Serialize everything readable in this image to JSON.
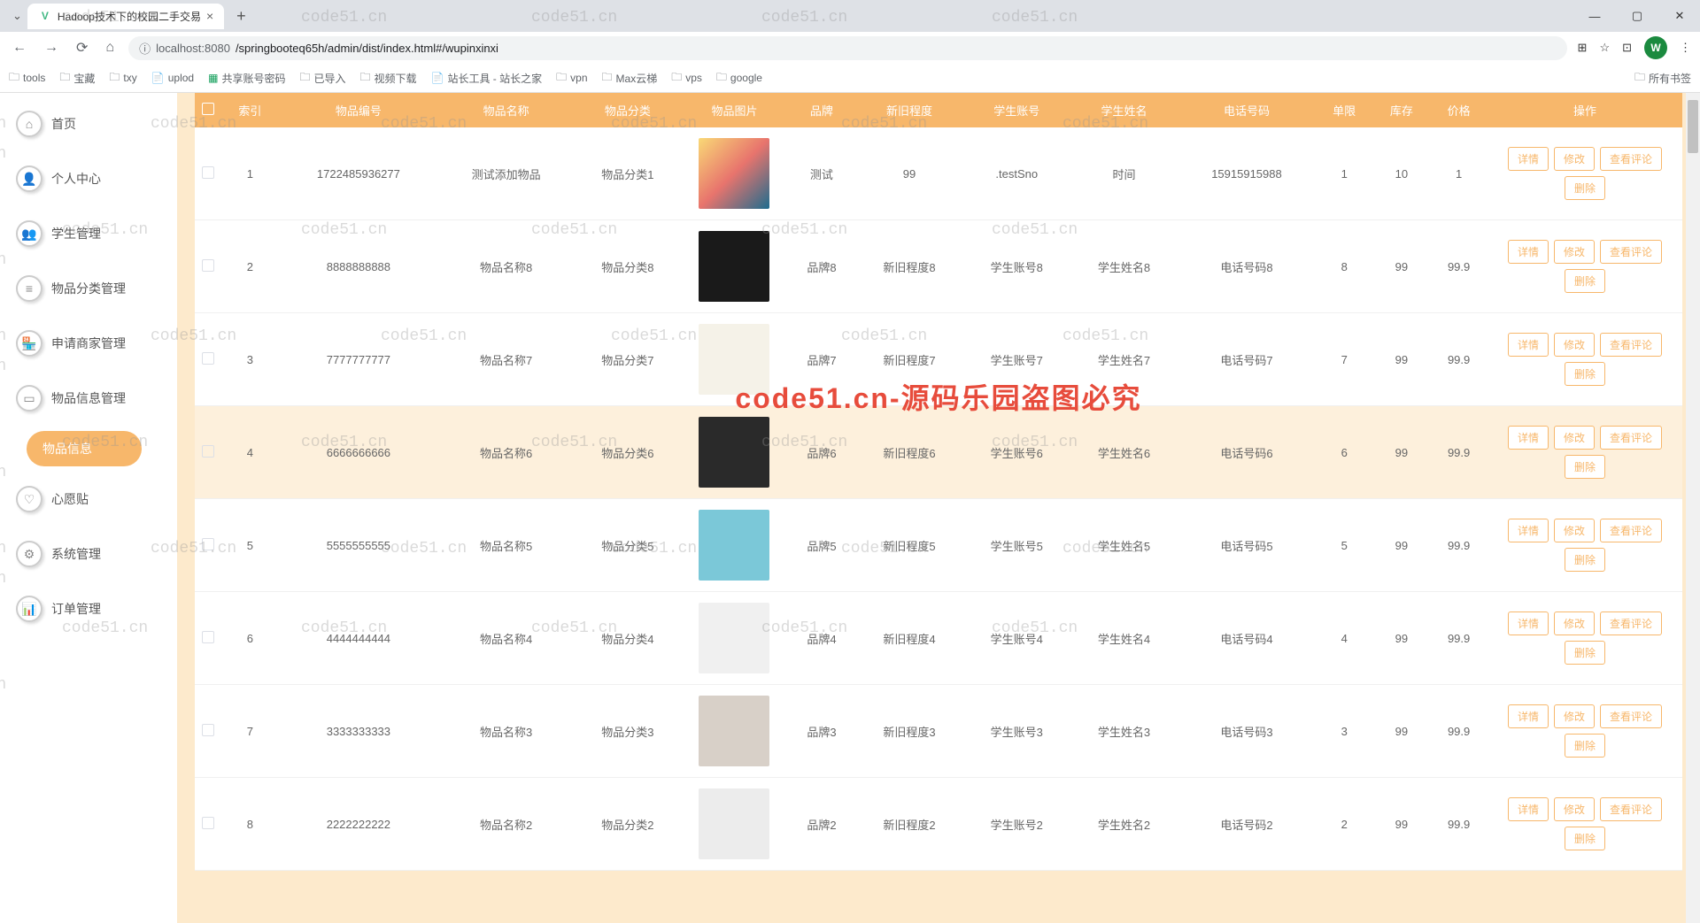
{
  "browser": {
    "tab_title": "Hadoop技术下的校园二手交易",
    "url_prefix": "localhost:8080",
    "url_path": "/springbooteq65h/admin/dist/index.html#/wupinxinxi",
    "bookmarks": [
      "tools",
      "宝藏",
      "txy",
      "uplod",
      "共享账号密码",
      "已导入",
      "视频下载",
      "站长工具 - 站长之家",
      "vpn",
      "Max云梯",
      "vps",
      "google"
    ],
    "all_bookmarks": "所有书签"
  },
  "sidebar": {
    "items": [
      {
        "label": "首页"
      },
      {
        "label": "个人中心"
      },
      {
        "label": "学生管理"
      },
      {
        "label": "物品分类管理"
      },
      {
        "label": "申请商家管理"
      },
      {
        "label": "物品信息管理"
      },
      {
        "label": "心愿贴"
      },
      {
        "label": "系统管理"
      },
      {
        "label": "订单管理"
      }
    ],
    "sub_active": "物品信息"
  },
  "table": {
    "headers": [
      "",
      "索引",
      "物品编号",
      "物品名称",
      "物品分类",
      "物品图片",
      "品牌",
      "新旧程度",
      "学生账号",
      "学生姓名",
      "电话号码",
      "单限",
      "库存",
      "价格",
      "操作"
    ],
    "ops": {
      "detail": "详情",
      "edit": "修改",
      "comment": "查看评论",
      "delete": "删除"
    },
    "rows": [
      {
        "idx": "1",
        "no": "1722485936277",
        "name": "测试添加物品",
        "cat": "物品分类1",
        "img": "i1",
        "brand": "测试",
        "cond": "99",
        "acct": ".testSno",
        "sname": "时间",
        "phone": "15915915988",
        "limit": "1",
        "stock": "10",
        "price": "1"
      },
      {
        "idx": "2",
        "no": "8888888888",
        "name": "物品名称8",
        "cat": "物品分类8",
        "img": "i2",
        "brand": "品牌8",
        "cond": "新旧程度8",
        "acct": "学生账号8",
        "sname": "学生姓名8",
        "phone": "电话号码8",
        "limit": "8",
        "stock": "99",
        "price": "99.9"
      },
      {
        "idx": "3",
        "no": "7777777777",
        "name": "物品名称7",
        "cat": "物品分类7",
        "img": "i3",
        "brand": "品牌7",
        "cond": "新旧程度7",
        "acct": "学生账号7",
        "sname": "学生姓名7",
        "phone": "电话号码7",
        "limit": "7",
        "stock": "99",
        "price": "99.9"
      },
      {
        "idx": "4",
        "no": "6666666666",
        "name": "物品名称6",
        "cat": "物品分类6",
        "img": "i4",
        "brand": "品牌6",
        "cond": "新旧程度6",
        "acct": "学生账号6",
        "sname": "学生姓名6",
        "phone": "电话号码6",
        "limit": "6",
        "stock": "99",
        "price": "99.9"
      },
      {
        "idx": "5",
        "no": "5555555555",
        "name": "物品名称5",
        "cat": "物品分类5",
        "img": "i5",
        "brand": "品牌5",
        "cond": "新旧程度5",
        "acct": "学生账号5",
        "sname": "学生姓名5",
        "phone": "电话号码5",
        "limit": "5",
        "stock": "99",
        "price": "99.9"
      },
      {
        "idx": "6",
        "no": "4444444444",
        "name": "物品名称4",
        "cat": "物品分类4",
        "img": "i6",
        "brand": "品牌4",
        "cond": "新旧程度4",
        "acct": "学生账号4",
        "sname": "学生姓名4",
        "phone": "电话号码4",
        "limit": "4",
        "stock": "99",
        "price": "99.9"
      },
      {
        "idx": "7",
        "no": "3333333333",
        "name": "物品名称3",
        "cat": "物品分类3",
        "img": "i7",
        "brand": "品牌3",
        "cond": "新旧程度3",
        "acct": "学生账号3",
        "sname": "学生姓名3",
        "phone": "电话号码3",
        "limit": "3",
        "stock": "99",
        "price": "99.9"
      },
      {
        "idx": "8",
        "no": "2222222222",
        "name": "物品名称2",
        "cat": "物品分类2",
        "img": "i8",
        "brand": "品牌2",
        "cond": "新旧程度2",
        "acct": "学生账号2",
        "sname": "学生姓名2",
        "phone": "电话号码2",
        "limit": "2",
        "stock": "99",
        "price": "99.9"
      }
    ]
  },
  "watermark": {
    "grey": "code51.cn",
    "red": "code51.cn-源码乐园盗图必究"
  }
}
